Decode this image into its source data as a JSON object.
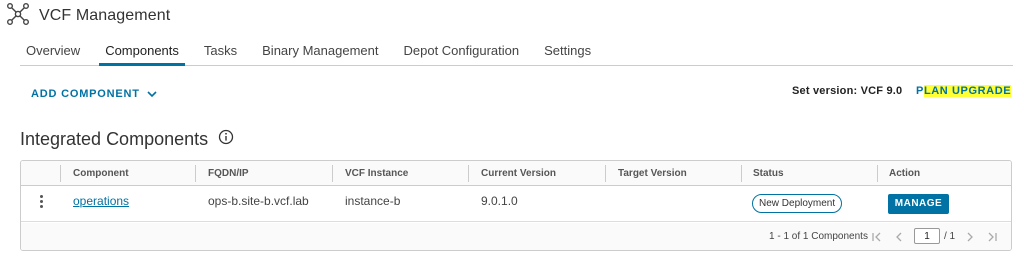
{
  "app": {
    "title": "VCF Management",
    "icon": "network-nodes-icon"
  },
  "tabs": [
    {
      "label": "Overview",
      "active": false
    },
    {
      "label": "Components",
      "active": true
    },
    {
      "label": "Tasks",
      "active": false
    },
    {
      "label": "Binary Management",
      "active": false
    },
    {
      "label": "Depot Configuration",
      "active": false
    },
    {
      "label": "Settings",
      "active": false
    }
  ],
  "toolbar": {
    "add_component_label": "ADD COMPONENT",
    "set_version_label": "Set version: VCF 9.0",
    "plan_upgrade_prefix": "P",
    "plan_upgrade_highlight": "LAN UPGRADE"
  },
  "section": {
    "title": "Integrated Components",
    "info_icon": "info-icon"
  },
  "table": {
    "columns": [
      "Component",
      "FQDN/IP",
      "VCF Instance",
      "Current Version",
      "Target Version",
      "Status",
      "Action"
    ],
    "rows": [
      {
        "component": "operations",
        "fqdn": "ops-b.site-b.vcf.lab",
        "instance": "instance-b",
        "current_version": "9.0.1.0",
        "target_version": "",
        "status": "New Deployment",
        "action": "MANAGE"
      }
    ],
    "footer": {
      "summary": "1 - 1 of 1 Components",
      "page": "1",
      "total_pages": "/ 1"
    }
  },
  "colors": {
    "accent": "#0072a3",
    "highlight": "#ffff33",
    "border": "#cccccc"
  }
}
